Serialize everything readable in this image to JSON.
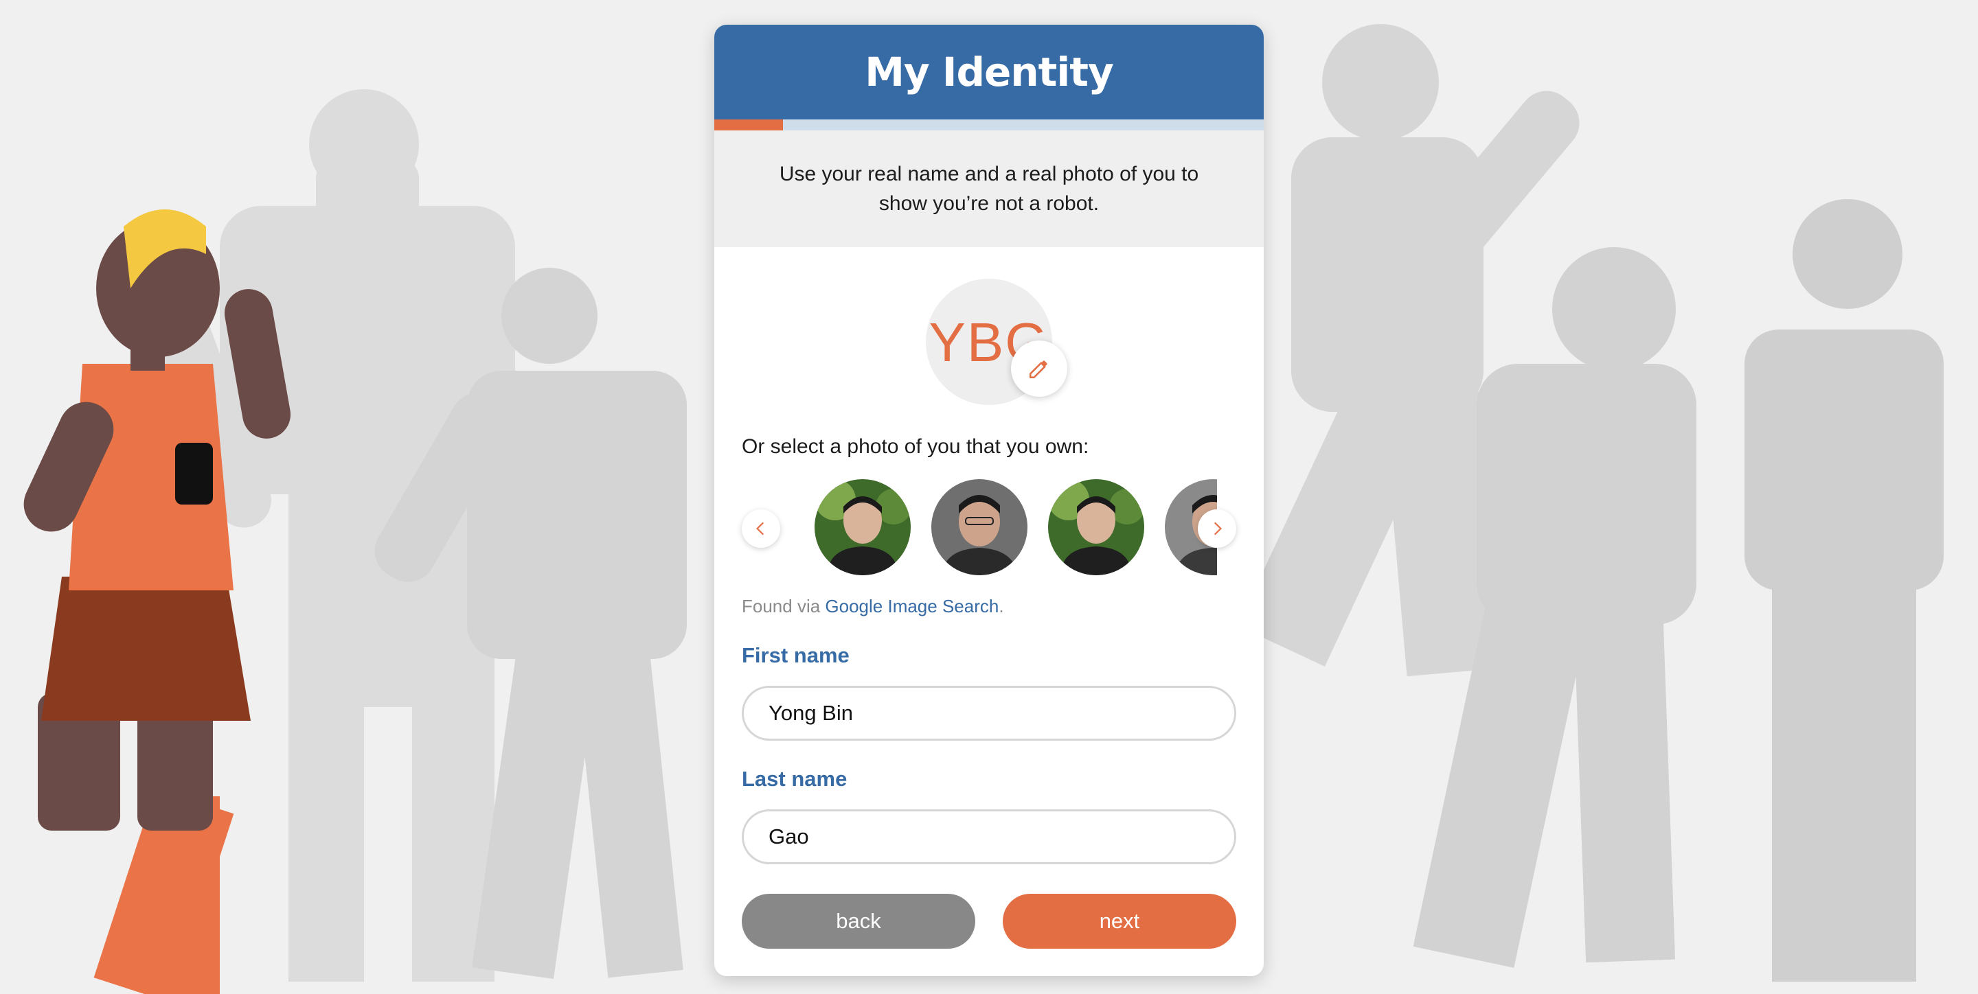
{
  "header": {
    "title": "My Identity"
  },
  "progress": {
    "fraction": 0.125
  },
  "intro": {
    "text": "Use your real name and a real photo of you to show you’re not a robot."
  },
  "avatar": {
    "initials": "YBG",
    "edit_icon": "pencil-icon"
  },
  "photo_picker": {
    "label": "Or select a photo of you that you own:",
    "prev_icon": "chevron-left-icon",
    "next_icon": "chevron-right-icon",
    "thumbnails": [
      {
        "icon": "photo-thumbnail",
        "style": "green-background"
      },
      {
        "icon": "photo-thumbnail",
        "style": "grey-background"
      },
      {
        "icon": "photo-thumbnail",
        "style": "green-background"
      },
      {
        "icon": "photo-thumbnail",
        "style": "grey-background"
      }
    ],
    "found_via_prefix": "Found via ",
    "found_via_link": "Google Image Search",
    "found_via_suffix": "."
  },
  "form": {
    "first_name_label": "First name",
    "first_name_value": "Yong Bin",
    "last_name_label": "Last name",
    "last_name_value": "Gao"
  },
  "actions": {
    "back_label": "back",
    "next_label": "next"
  },
  "colors": {
    "primary_blue": "#366ba5",
    "accent_orange": "#e36e44",
    "button_grey": "#888888"
  }
}
